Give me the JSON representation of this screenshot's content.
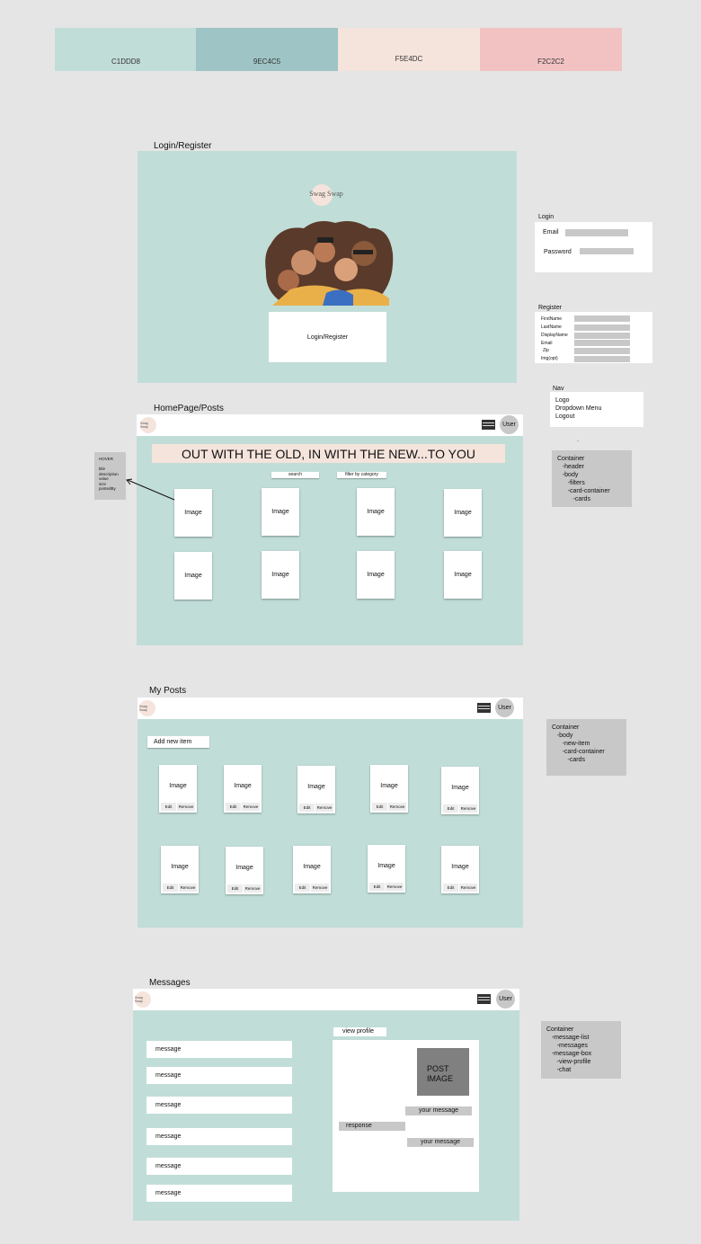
{
  "palette": [
    {
      "label": "C1DDD8",
      "color": "#c1ddd8"
    },
    {
      "label": "9EC4C5",
      "color": "#9ec4c5"
    },
    {
      "label": "F5E4DC",
      "color": "#f5e4dc"
    },
    {
      "label": "F2C2C2",
      "color": "#f2c2c2"
    }
  ],
  "login_section": {
    "title": "Login/Register",
    "logo": "Swag Swap",
    "button": "Login/Register"
  },
  "login_panel": {
    "title": "Login",
    "email_label": "Email",
    "password_label": "Password"
  },
  "register_panel": {
    "title": "Register",
    "fields": [
      "FirstName",
      "LastName",
      "DisplayName",
      "Email",
      "Zip",
      "Img(opt)"
    ]
  },
  "nav_panel": {
    "title": "Nav",
    "items": [
      "Logo",
      "Dropdown Menu",
      "Logout"
    ]
  },
  "home_section": {
    "title": "HomePage/Posts",
    "logo": "Swag Swap",
    "user": "User",
    "banner": "OUT WITH THE OLD, IN WITH THE NEW...TO YOU",
    "search": "search",
    "filter": "filter by category",
    "card_label": "Image",
    "hover_note": [
      "HOVER",
      "",
      "title",
      "description",
      "value",
      "size",
      "postedBy"
    ],
    "dash": "-"
  },
  "home_container_note": [
    "Container",
    "   -header",
    "   -body",
    "      -filters",
    "      -card-container",
    "         -cards"
  ],
  "myposts_section": {
    "title": "My Posts",
    "logo": "Swag Swap",
    "user": "User",
    "add_button": "Add new item",
    "card_label": "Image",
    "edit": "Edit",
    "remove": "Remove"
  },
  "myposts_container_note": [
    "Container",
    "   -body",
    "      -new-item",
    "      -card-container",
    "         -cards"
  ],
  "messages_section": {
    "title": "Messages",
    "logo": "Swag Swap",
    "user": "User",
    "messages": [
      "message",
      "message",
      "message",
      "message",
      "message",
      "message"
    ],
    "view_profile": "view profile",
    "post_image": "POST\nIMAGE",
    "your_message": "your message",
    "response": "response"
  },
  "messages_container_note": [
    "Container",
    "   -message-list",
    "      -messages",
    "   -message-box",
    "      -view-profile",
    "      -chat"
  ]
}
